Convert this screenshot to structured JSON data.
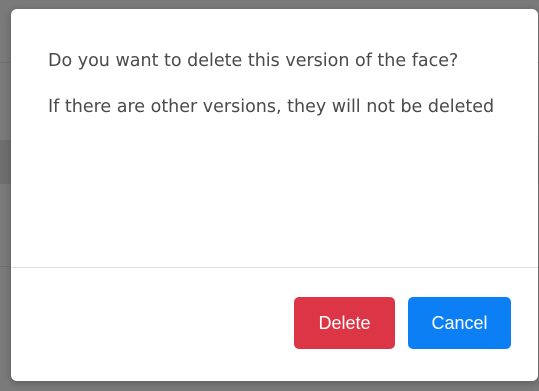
{
  "dialog": {
    "message_line1": "Do you want to delete this version of the face?",
    "message_line2": "If there are other versions, they will not be deleted",
    "delete_label": "Delete",
    "cancel_label": "Cancel"
  },
  "colors": {
    "delete": "#dc3545",
    "cancel": "#0d7ff5",
    "backdrop": "#7a7a7a"
  }
}
